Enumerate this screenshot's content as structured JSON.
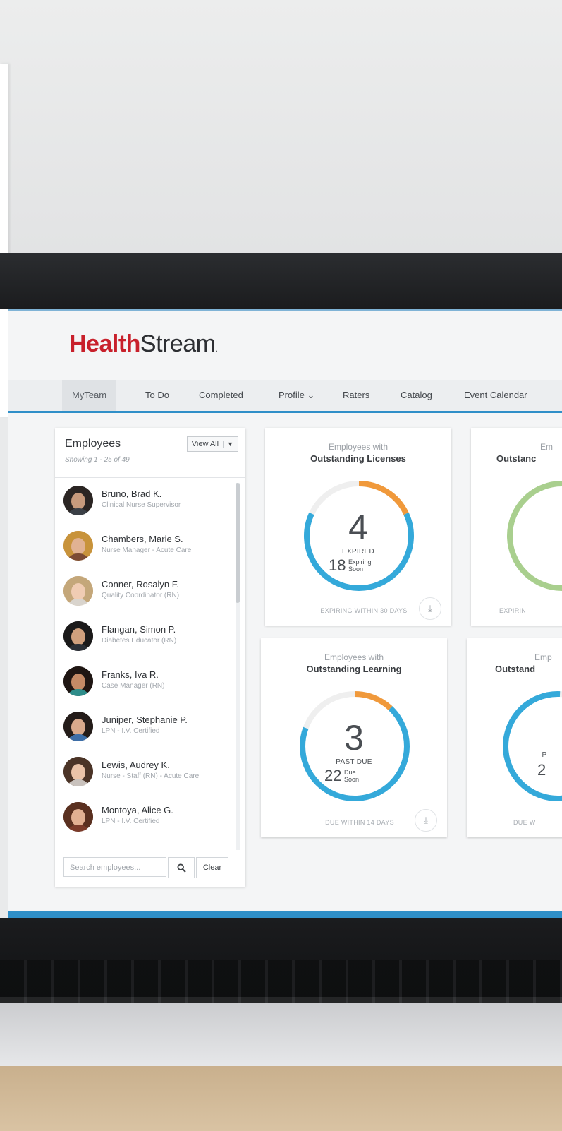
{
  "brand": {
    "primary": "Health",
    "secondary": "Stream",
    "mark": "."
  },
  "nav": {
    "items": [
      {
        "label": "MyTeam",
        "active": true
      },
      {
        "label": "To Do"
      },
      {
        "label": "Completed"
      },
      {
        "label": "Profile ⌄"
      },
      {
        "label": "Raters"
      },
      {
        "label": "Catalog"
      },
      {
        "label": "Event Calendar"
      }
    ]
  },
  "employees": {
    "heading": "Employees",
    "showing": "Showing 1 - 25 of 49",
    "view_all": "View All",
    "list": [
      {
        "name": "Bruno, Brad K.",
        "title": "Clinical Nurse Supervisor",
        "hair": "#2b2523",
        "face": "#c79a7c",
        "body": "#3a3f46"
      },
      {
        "name": "Chambers, Marie S.",
        "title": "Nurse Manager - Acute Care",
        "hair": "#c8933b",
        "face": "#e1b293",
        "body": "#7c4b34"
      },
      {
        "name": "Conner, Rosalyn F.",
        "title": "Quality Coordinator (RN)",
        "hair": "#c4a77a",
        "face": "#f0ccb3",
        "body": "#d9d4cd"
      },
      {
        "name": "Flangan, Simon P.",
        "title": "Diabetes Educator (RN)",
        "hair": "#1b1a1a",
        "face": "#d0a07d",
        "body": "#2b2f36"
      },
      {
        "name": "Franks, Iva R.",
        "title": "Case Manager (RN)",
        "hair": "#1f1613",
        "face": "#c48a66",
        "body": "#2e8d8a"
      },
      {
        "name": "Juniper, Stephanie P.",
        "title": "LPN - I.V. Certified",
        "hair": "#241c19",
        "face": "#d8a98c",
        "body": "#3d6ea8"
      },
      {
        "name": "Lewis, Audrey K.",
        "title": "Nurse - Staff (RN) - Acute Care",
        "hair": "#4b3427",
        "face": "#eac3a8",
        "body": "#c9c2bd"
      },
      {
        "name": "Montoya, Alice G.",
        "title": "LPN - I.V. Certified",
        "hair": "#5a3020",
        "face": "#e2b092",
        "body": "#7b3b2a"
      }
    ],
    "search_placeholder": "Search employees...",
    "search_icon": "search-icon",
    "clear_label": "Clear"
  },
  "cards": [
    {
      "sub": "Employees with",
      "title": "Outstanding Licenses",
      "main_value": "4",
      "main_label": "EXPIRED",
      "secondary_value": "18",
      "secondary_label_1": "Expiring",
      "secondary_label_2": "Soon",
      "footer": "EXPIRING WITHIN 30 DAYS",
      "ring_orange_fraction": 0.18,
      "ring_blue_fraction": 0.82
    },
    {
      "sub": "Employees with",
      "title": "Outstanding Learning",
      "main_value": "3",
      "main_label": "PAST DUE",
      "secondary_value": "22",
      "secondary_label_1": "Due",
      "secondary_label_2": "Soon",
      "footer": "DUE WITHIN 14 DAYS",
      "ring_orange_fraction": 0.12,
      "ring_blue_fraction": 0.88
    }
  ],
  "partial_cards": [
    {
      "sub": "Em",
      "title": "Outstanc",
      "footer": "EXPIRIN"
    },
    {
      "sub": "Emp",
      "title": "Outstand",
      "main_label": "P",
      "secondary_value": "2",
      "footer": "DUE W"
    }
  ],
  "colors": {
    "brand_red": "#c8202b",
    "accent_blue": "#2f8fc8",
    "ring_blue": "#34a9da",
    "ring_orange": "#f0993b",
    "ring_green": "#a9cf8e"
  }
}
